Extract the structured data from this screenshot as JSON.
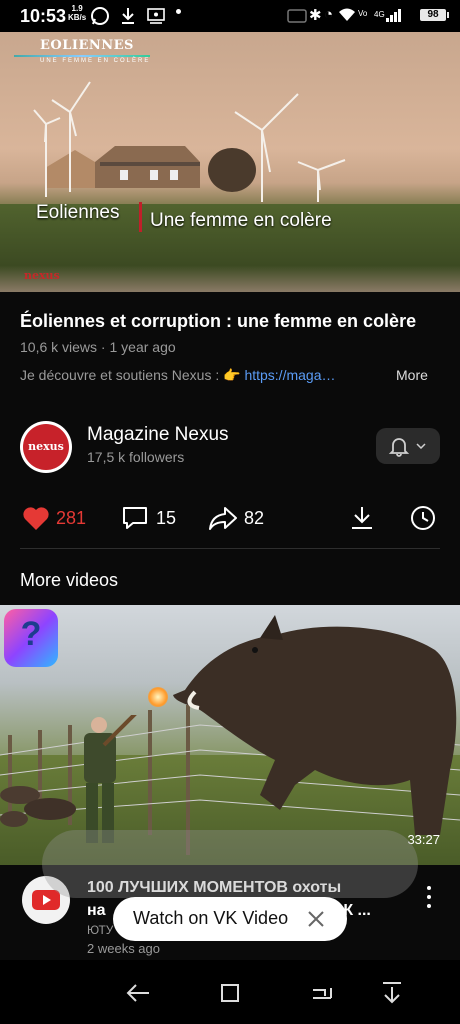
{
  "status_bar": {
    "time": "10:53",
    "net_speed": "1.9",
    "net_unit": "KB/s",
    "battery": "98",
    "network_type": "4G"
  },
  "hero_video": {
    "logo_title": "EOLIENNES",
    "logo_subtitle": "UNE FEMME EN COLÈRE",
    "caption_left": "Eoliennes",
    "caption_right": "Une femme en colère",
    "brand": "nexus"
  },
  "video": {
    "title": "Éoliennes et corruption : une femme en colère",
    "views": "10,6 k views",
    "age": "1 year ago",
    "separator": " · ",
    "description_prefix": "Je découvre et soutiens Nexus : 👉 ",
    "description_link": "https://maga…",
    "more_label": "More"
  },
  "channel": {
    "avatar_text": "nexus",
    "name": "Magazine Nexus",
    "followers": "17,5 k followers"
  },
  "actions": {
    "likes": "281",
    "comments": "15",
    "shares": "82"
  },
  "more_videos": {
    "heading": "More videos",
    "item": {
      "duration": "33:27",
      "title_line1": "100 ЛУЧШИХ МОМЕНТОВ охоты",
      "title_line2_start": "на",
      "title_line2_end": "КАК ...",
      "channel_partial": "ЮТУ",
      "age": "2 weeks ago"
    }
  },
  "vk_banner": {
    "label": "Watch on VK Video"
  },
  "colors": {
    "like_red": "#e53935",
    "link_blue": "#5b9cf5",
    "nexus_red": "#c7222a"
  }
}
